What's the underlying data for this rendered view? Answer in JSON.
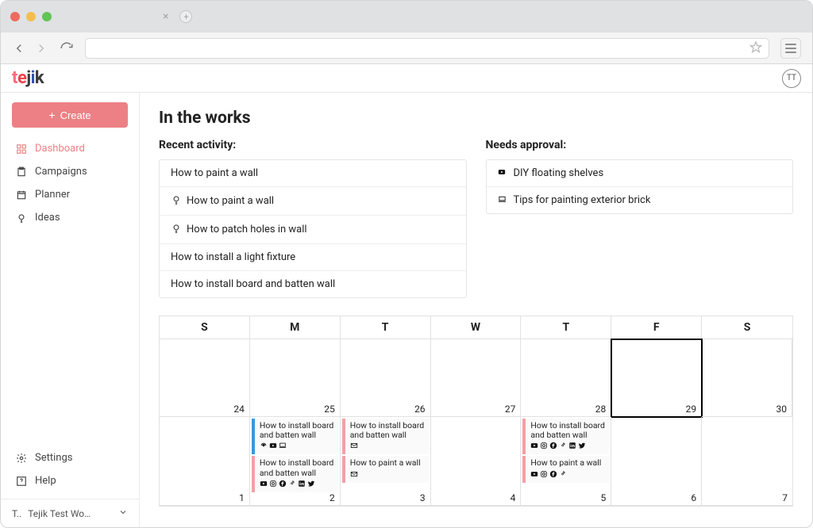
{
  "chrome": {
    "traffic_colors": [
      "#ed6a5e",
      "#f4be4f",
      "#61c454"
    ]
  },
  "header": {
    "logo_text": "tejik",
    "user_initials": "TT"
  },
  "sidebar": {
    "create_label": "Create",
    "items": [
      {
        "label": "Dashboard",
        "icon": "grid",
        "active": true
      },
      {
        "label": "Campaigns",
        "icon": "square-doc",
        "active": false
      },
      {
        "label": "Planner",
        "icon": "calendar",
        "active": false
      },
      {
        "label": "Ideas",
        "icon": "bulb",
        "active": false
      }
    ],
    "bottom_items": [
      {
        "label": "Settings",
        "icon": "gear"
      },
      {
        "label": "Help",
        "icon": "help"
      }
    ],
    "workspace_prefix": "T..",
    "workspace_name": "Tejik Test Wo…"
  },
  "page": {
    "title": "In the works",
    "recent_label": "Recent activity:",
    "approval_label": "Needs approval:",
    "recent_activity": [
      {
        "icon": "",
        "label": "How to paint a wall"
      },
      {
        "icon": "bulb",
        "label": "How to paint a wall"
      },
      {
        "icon": "bulb",
        "label": "How to patch holes in wall"
      },
      {
        "icon": "",
        "label": "How to install a light fixture"
      },
      {
        "icon": "",
        "label": "How to install board and batten wall"
      }
    ],
    "needs_approval": [
      {
        "icon": "youtube",
        "label": "DIY floating shelves"
      },
      {
        "icon": "laptop",
        "label": "Tips for painting exterior brick"
      }
    ]
  },
  "calendar": {
    "day_headers": [
      "S",
      "M",
      "T",
      "W",
      "T",
      "F",
      "S"
    ],
    "weeks": [
      {
        "days": [
          {
            "num": "24",
            "today": false,
            "events": []
          },
          {
            "num": "25",
            "today": false,
            "events": []
          },
          {
            "num": "26",
            "today": false,
            "events": []
          },
          {
            "num": "27",
            "today": false,
            "events": []
          },
          {
            "num": "28",
            "today": false,
            "events": []
          },
          {
            "num": "29",
            "today": true,
            "events": []
          },
          {
            "num": "30",
            "today": false,
            "events": []
          }
        ]
      },
      {
        "days": [
          {
            "num": "1",
            "today": false,
            "events": []
          },
          {
            "num": "2",
            "today": false,
            "events": [
              {
                "color": "blue",
                "title": "How to install board and batten wall",
                "icons": [
                  "podcast",
                  "youtube",
                  "laptop"
                ]
              },
              {
                "color": "pink",
                "title": "How to install board and batten wall",
                "icons": [
                  "youtube",
                  "instagram",
                  "facebook",
                  "tiktok",
                  "linkedin",
                  "twitter"
                ]
              }
            ]
          },
          {
            "num": "3",
            "today": false,
            "events": [
              {
                "color": "pink",
                "title": "How to install board and batten wall",
                "icons": [
                  "mail"
                ]
              },
              {
                "color": "pink",
                "title": "How to paint a wall",
                "icons": [
                  "mail"
                ]
              }
            ]
          },
          {
            "num": "4",
            "today": false,
            "events": []
          },
          {
            "num": "5",
            "today": false,
            "events": [
              {
                "color": "pink",
                "title": "How to install board and batten wall",
                "icons": [
                  "youtube",
                  "instagram",
                  "facebook",
                  "tiktok",
                  "linkedin",
                  "twitter"
                ]
              },
              {
                "color": "pink",
                "title": "How to paint a wall",
                "icons": [
                  "youtube",
                  "instagram",
                  "facebook",
                  "tiktok"
                ]
              }
            ]
          },
          {
            "num": "6",
            "today": false,
            "events": []
          },
          {
            "num": "7",
            "today": false,
            "events": []
          }
        ]
      }
    ]
  }
}
